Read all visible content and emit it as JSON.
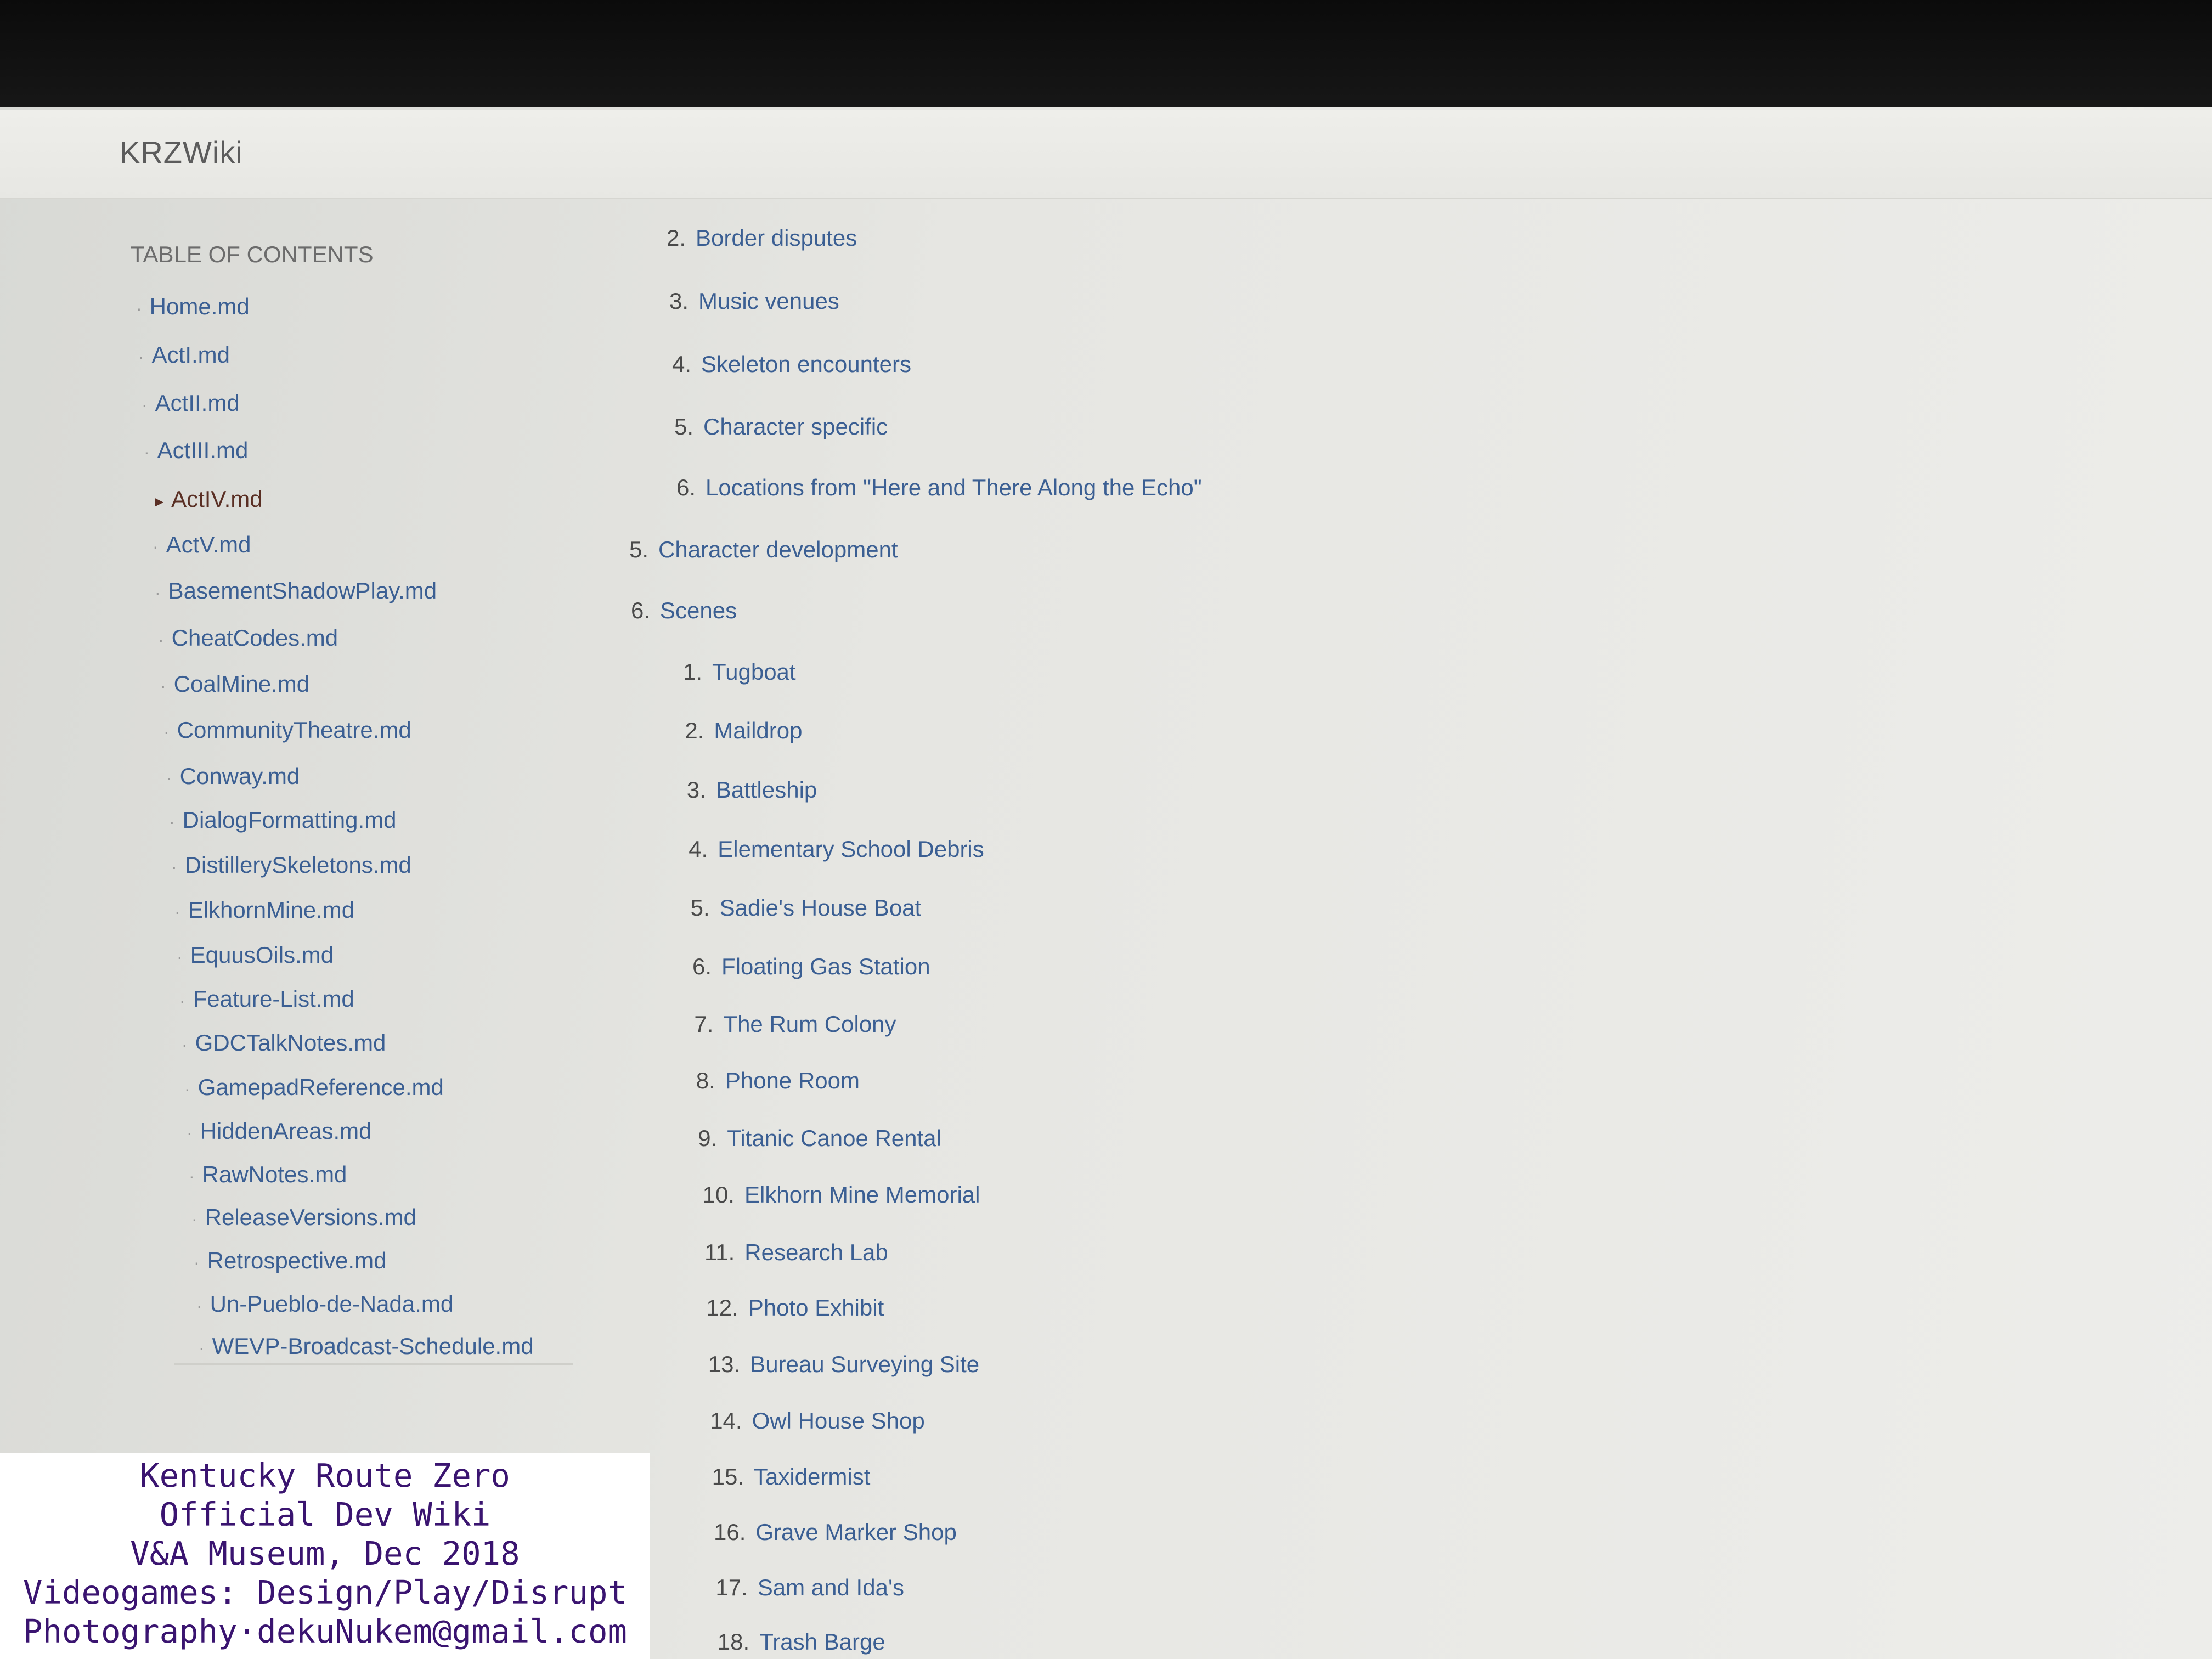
{
  "header": {
    "brand": "KRZWiki"
  },
  "sidebar": {
    "title": "TABLE OF CONTENTS",
    "items": [
      {
        "label": "Home.md"
      },
      {
        "label": "ActI.md"
      },
      {
        "label": "ActII.md"
      },
      {
        "label": "ActIII.md"
      },
      {
        "label": "ActIV.md",
        "active": true
      },
      {
        "label": "ActV.md"
      },
      {
        "label": "BasementShadowPlay.md"
      },
      {
        "label": "CheatCodes.md"
      },
      {
        "label": "CoalMine.md"
      },
      {
        "label": "CommunityTheatre.md"
      },
      {
        "label": "Conway.md"
      },
      {
        "label": "DialogFormatting.md"
      },
      {
        "label": "DistillerySkeletons.md"
      },
      {
        "label": "ElkhornMine.md"
      },
      {
        "label": "EquusOils.md"
      },
      {
        "label": "Feature-List.md"
      },
      {
        "label": "GDCTalkNotes.md"
      },
      {
        "label": "GamepadReference.md"
      },
      {
        "label": "HiddenAreas.md"
      },
      {
        "label": "RawNotes.md"
      },
      {
        "label": "ReleaseVersions.md"
      },
      {
        "label": "Retrospective.md"
      },
      {
        "label": "Un-Pueblo-de-Nada.md"
      },
      {
        "label": "WEVP-Broadcast-Schedule.md"
      }
    ]
  },
  "content": {
    "sub_items_top": [
      {
        "num": "2.",
        "label": "Border disputes"
      },
      {
        "num": "3.",
        "label": "Music venues"
      },
      {
        "num": "4.",
        "label": "Skeleton encounters"
      },
      {
        "num": "5.",
        "label": "Character specific"
      },
      {
        "num": "6.",
        "label": "Locations from \"Here and There Along the Echo\""
      }
    ],
    "sections": [
      {
        "num": "5.",
        "label": "Character development"
      },
      {
        "num": "6.",
        "label": "Scenes"
      }
    ],
    "scenes": [
      {
        "num": "1.",
        "label": "Tugboat"
      },
      {
        "num": "2.",
        "label": "Maildrop"
      },
      {
        "num": "3.",
        "label": "Battleship"
      },
      {
        "num": "4.",
        "label": "Elementary School Debris"
      },
      {
        "num": "5.",
        "label": "Sadie's House Boat"
      },
      {
        "num": "6.",
        "label": "Floating Gas Station"
      },
      {
        "num": "7.",
        "label": "The Rum Colony"
      },
      {
        "num": "8.",
        "label": "Phone Room"
      },
      {
        "num": "9.",
        "label": "Titanic Canoe Rental"
      },
      {
        "num": "10.",
        "label": "Elkhorn Mine Memorial"
      },
      {
        "num": "11.",
        "label": "Research Lab"
      },
      {
        "num": "12.",
        "label": "Photo Exhibit"
      },
      {
        "num": "13.",
        "label": "Bureau Surveying Site"
      },
      {
        "num": "14.",
        "label": "Owl House Shop"
      },
      {
        "num": "15.",
        "label": "Taxidermist"
      },
      {
        "num": "16.",
        "label": "Grave Marker Shop"
      },
      {
        "num": "17.",
        "label": "Sam and Ida's"
      },
      {
        "num": "18.",
        "label": "Trash Barge"
      }
    ]
  },
  "watermark": {
    "lines": [
      "Kentucky Route Zero",
      "Official Dev Wiki",
      "V&A Museum, Dec 2018",
      "Videogames: Design/Play/Disrupt",
      "Photography·dekuNukem@gmail.com"
    ]
  }
}
